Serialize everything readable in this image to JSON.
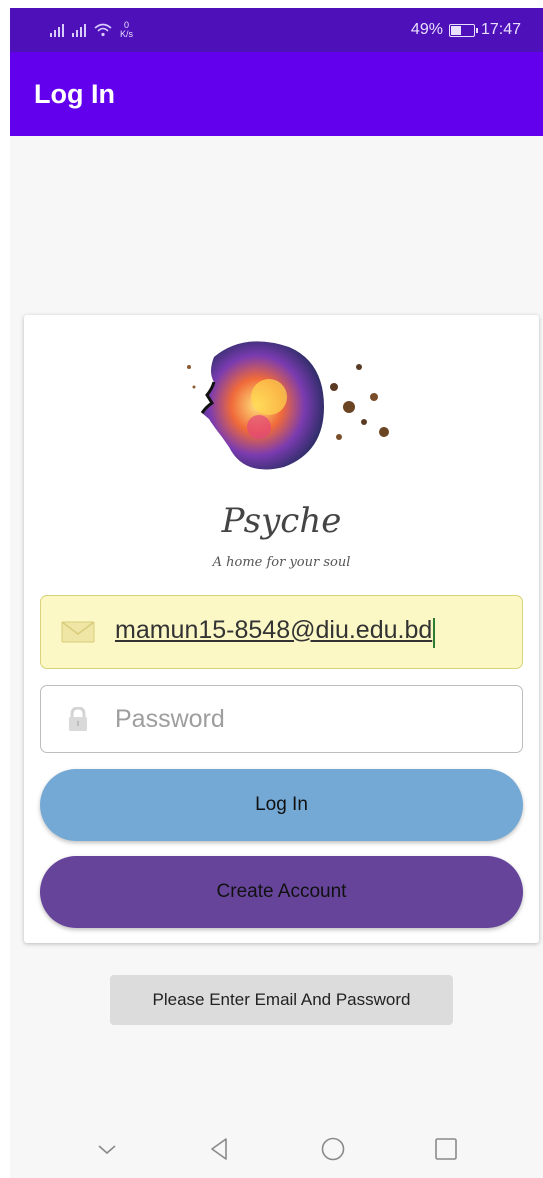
{
  "status_bar": {
    "net_speed_value": "0",
    "net_speed_unit": "K/s",
    "battery_percent": "49%",
    "battery_level": 0.49,
    "time": "17:47"
  },
  "app_bar": {
    "title": "Log In"
  },
  "logo": {
    "brand_name": "Psyche",
    "tagline": "A home for your soul"
  },
  "form": {
    "email": {
      "value": "mamun15-8548@diu.edu.bd",
      "icon": "mail-icon"
    },
    "password": {
      "placeholder": "Password",
      "icon": "lock-icon"
    }
  },
  "buttons": {
    "login_label": "Log In",
    "create_label": "Create Account"
  },
  "toast": {
    "message": "Please Enter Email And Password"
  },
  "colors": {
    "status_bar": "#4e10b8",
    "app_bar": "#6200ee",
    "login_button": "#74a9d5",
    "create_button": "#65449a",
    "email_field_bg": "#fbf8c6"
  },
  "nav_bar": {
    "icons": [
      "chevron-down-icon",
      "back-icon",
      "home-icon",
      "recents-icon"
    ]
  }
}
